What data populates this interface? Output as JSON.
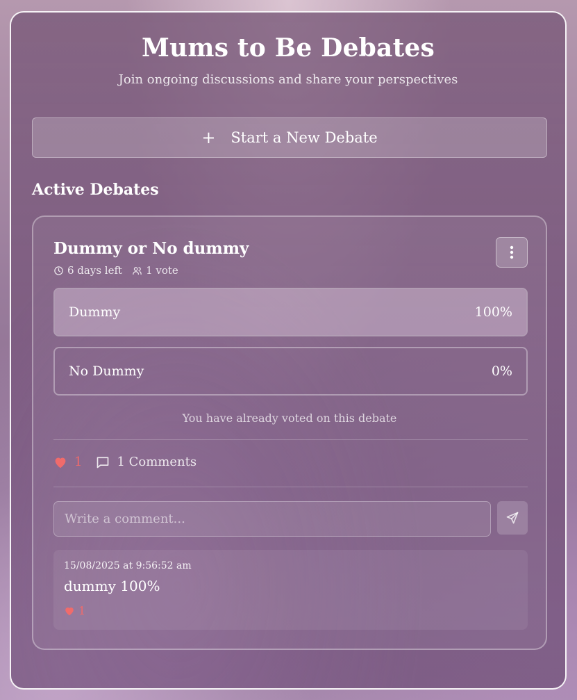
{
  "header": {
    "title": "Mums to Be Debates",
    "subtitle": "Join ongoing discussions and share your perspectives"
  },
  "new_debate": {
    "icon": "plus-icon",
    "label": "Start a New Debate"
  },
  "section": {
    "heading": "Active Debates"
  },
  "debate": {
    "title": "Dummy or No dummy",
    "time_left": "6 days left",
    "votes": "1 vote",
    "options": [
      {
        "label": "Dummy",
        "percent_text": "100%",
        "percent": 100
      },
      {
        "label": "No Dummy",
        "percent_text": "0%",
        "percent": 0
      }
    ],
    "voted_note": "You have already voted on this debate",
    "likes": "1",
    "comments_label": "1 Comments",
    "comment_placeholder": "Write a comment...",
    "comment_list": [
      {
        "timestamp": "15/08/2025 at 9:56:52 am",
        "text": "dummy 100%",
        "likes": "1"
      }
    ]
  },
  "colors": {
    "heart": "#f06b6b",
    "panel_border": "#ffffff"
  }
}
